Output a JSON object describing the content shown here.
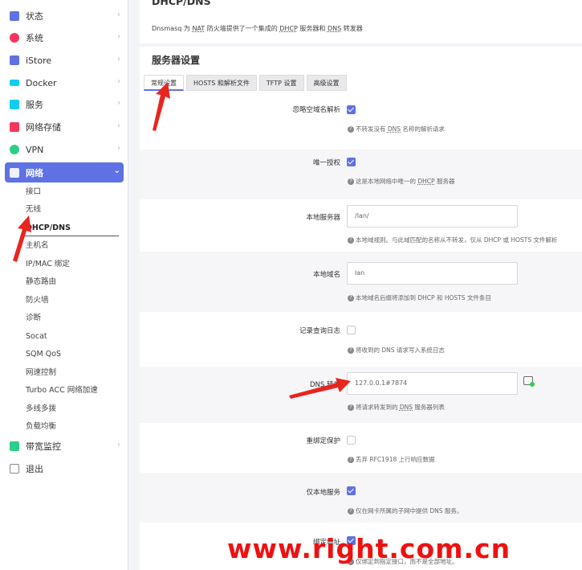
{
  "sidebar": {
    "items": [
      {
        "label": "状态",
        "icon": "status-icon",
        "color": "#5e72e4"
      },
      {
        "label": "系统",
        "icon": "gear-icon",
        "color": "#f5365c"
      },
      {
        "label": "iStore",
        "icon": "cube-icon",
        "color": "#5e72e4"
      },
      {
        "label": "Docker",
        "icon": "docker-icon",
        "color": "#11cdef"
      },
      {
        "label": "服务",
        "icon": "puzzle-icon",
        "color": "#11cdef"
      },
      {
        "label": "网络存储",
        "icon": "storage-icon",
        "color": "#f5365c"
      },
      {
        "label": "VPN",
        "icon": "vpn-icon",
        "color": "#2dce89"
      },
      {
        "label": "网络",
        "icon": "network-icon",
        "color": "#ffffff"
      }
    ],
    "network_sub": [
      "接口",
      "无线",
      "DHCP/DNS",
      "主机名",
      "IP/MAC 绑定",
      "静态路由",
      "防火墙",
      "诊断",
      "Socat",
      "SQM QoS",
      "网速控制",
      "Turbo ACC 网络加速",
      "多线多拨",
      "负载均衡"
    ],
    "bottom_items": [
      {
        "label": "带宽监控",
        "icon": "monitor-icon",
        "color": "#2dce89"
      },
      {
        "label": "退出",
        "icon": "logout-icon",
        "color": "#888888"
      }
    ]
  },
  "page": {
    "title": "DHCP/DNS",
    "desc_prefix": "Dnsmasq 为 ",
    "desc_nat": "NAT",
    "desc_mid": " 防火墙提供了一个集成的 ",
    "desc_dhcp": "DHCP",
    "desc_mid2": " 服务器和 ",
    "desc_dns": "DNS",
    "desc_suffix": " 转发器"
  },
  "section": {
    "title": "服务器设置",
    "tabs": [
      "常规设置",
      "HOSTS 和解析文件",
      "TFTP 设置",
      "高级设置"
    ]
  },
  "fields": {
    "domain_needed": {
      "label": "忽略空域名解析",
      "checked": true,
      "help_a": "不转发没有 ",
      "help_u": "DNS",
      "help_b": " 名称的解析请求"
    },
    "authoritative": {
      "label": "唯一授权",
      "checked": true,
      "help_a": "这是本地网络中唯一的 ",
      "help_u": "DHCP",
      "help_b": " 服务器"
    },
    "local_server": {
      "label": "本地服务器",
      "value": "/lan/",
      "help": "本地域规则。与此域匹配的名称从不转发，仅从 DHCP 或 HOSTS 文件解析"
    },
    "local_domain": {
      "label": "本地域名",
      "value": "lan",
      "help": "本地域名后缀将添加到 DHCP 和 HOSTS 文件条目"
    },
    "log_queries": {
      "label": "记录查询日志",
      "checked": false,
      "help": "将收到的 DNS 请求写入系统日志"
    },
    "dns_forward": {
      "label": "DNS 转发",
      "value": "127.0.0.1#7874",
      "help_a": "将请求转发到的 ",
      "help_u": "DNS",
      "help_b": " 服务器列表"
    },
    "rebind_protection": {
      "label": "重绑定保护",
      "checked": false,
      "help": "丢弃 RFC1918 上行响应数据"
    },
    "local_service": {
      "label": "仅本地服务",
      "checked": true,
      "help": "仅在网卡所属的子网中提供 DNS 服务。"
    },
    "bind_addr": {
      "label": "绑定地址",
      "help": "仅绑定到指定接口，而不是全部地址。"
    }
  },
  "watermark": "www.right.com.cn"
}
